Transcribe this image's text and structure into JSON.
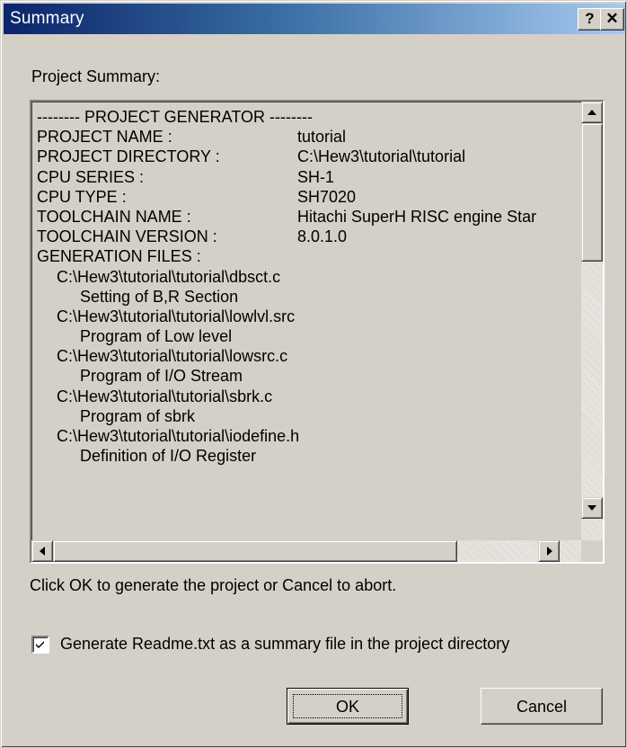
{
  "window": {
    "title": "Summary",
    "help_glyph": "?",
    "close_glyph": "✕"
  },
  "labels": {
    "project_summary": "Project Summary:",
    "instruction": "Click OK to generate the project or Cancel to abort."
  },
  "summary": {
    "header": "-------- PROJECT GENERATOR --------",
    "fields": [
      {
        "key": "PROJECT NAME :",
        "value": "tutorial"
      },
      {
        "key": "PROJECT DIRECTORY :",
        "value": "C:\\Hew3\\tutorial\\tutorial"
      },
      {
        "key": "CPU SERIES :",
        "value": "SH-1"
      },
      {
        "key": "CPU TYPE :",
        "value": "SH7020"
      },
      {
        "key": "TOOLCHAIN NAME :",
        "value": "Hitachi SuperH RISC engine Star"
      },
      {
        "key": "TOOLCHAIN VERSION :",
        "value": "8.0.1.0"
      }
    ],
    "files_header": "GENERATION FILES :",
    "files": [
      {
        "path": "C:\\Hew3\\tutorial\\tutorial\\dbsct.c",
        "desc": "Setting of B,R Section"
      },
      {
        "path": "C:\\Hew3\\tutorial\\tutorial\\lowlvl.src",
        "desc": "Program of Low level"
      },
      {
        "path": "C:\\Hew3\\tutorial\\tutorial\\lowsrc.c",
        "desc": "Program of I/O Stream"
      },
      {
        "path": "C:\\Hew3\\tutorial\\tutorial\\sbrk.c",
        "desc": "Program of sbrk"
      },
      {
        "path": "C:\\Hew3\\tutorial\\tutorial\\iodefine.h",
        "desc": "Definition of I/O Register"
      }
    ]
  },
  "scroll": {
    "vertical_position": 0,
    "horizontal_position": 0
  },
  "checkbox": {
    "checked": true,
    "label": "Generate Readme.txt as a summary file in the project directory"
  },
  "buttons": {
    "ok": "OK",
    "cancel": "Cancel"
  },
  "colors": {
    "title_start": "#0a246a",
    "title_end": "#a6caf0",
    "face": "#d4d0c8"
  },
  "icons": {
    "help": "help-icon",
    "close": "close-icon",
    "checkmark": "checkmark-icon"
  }
}
